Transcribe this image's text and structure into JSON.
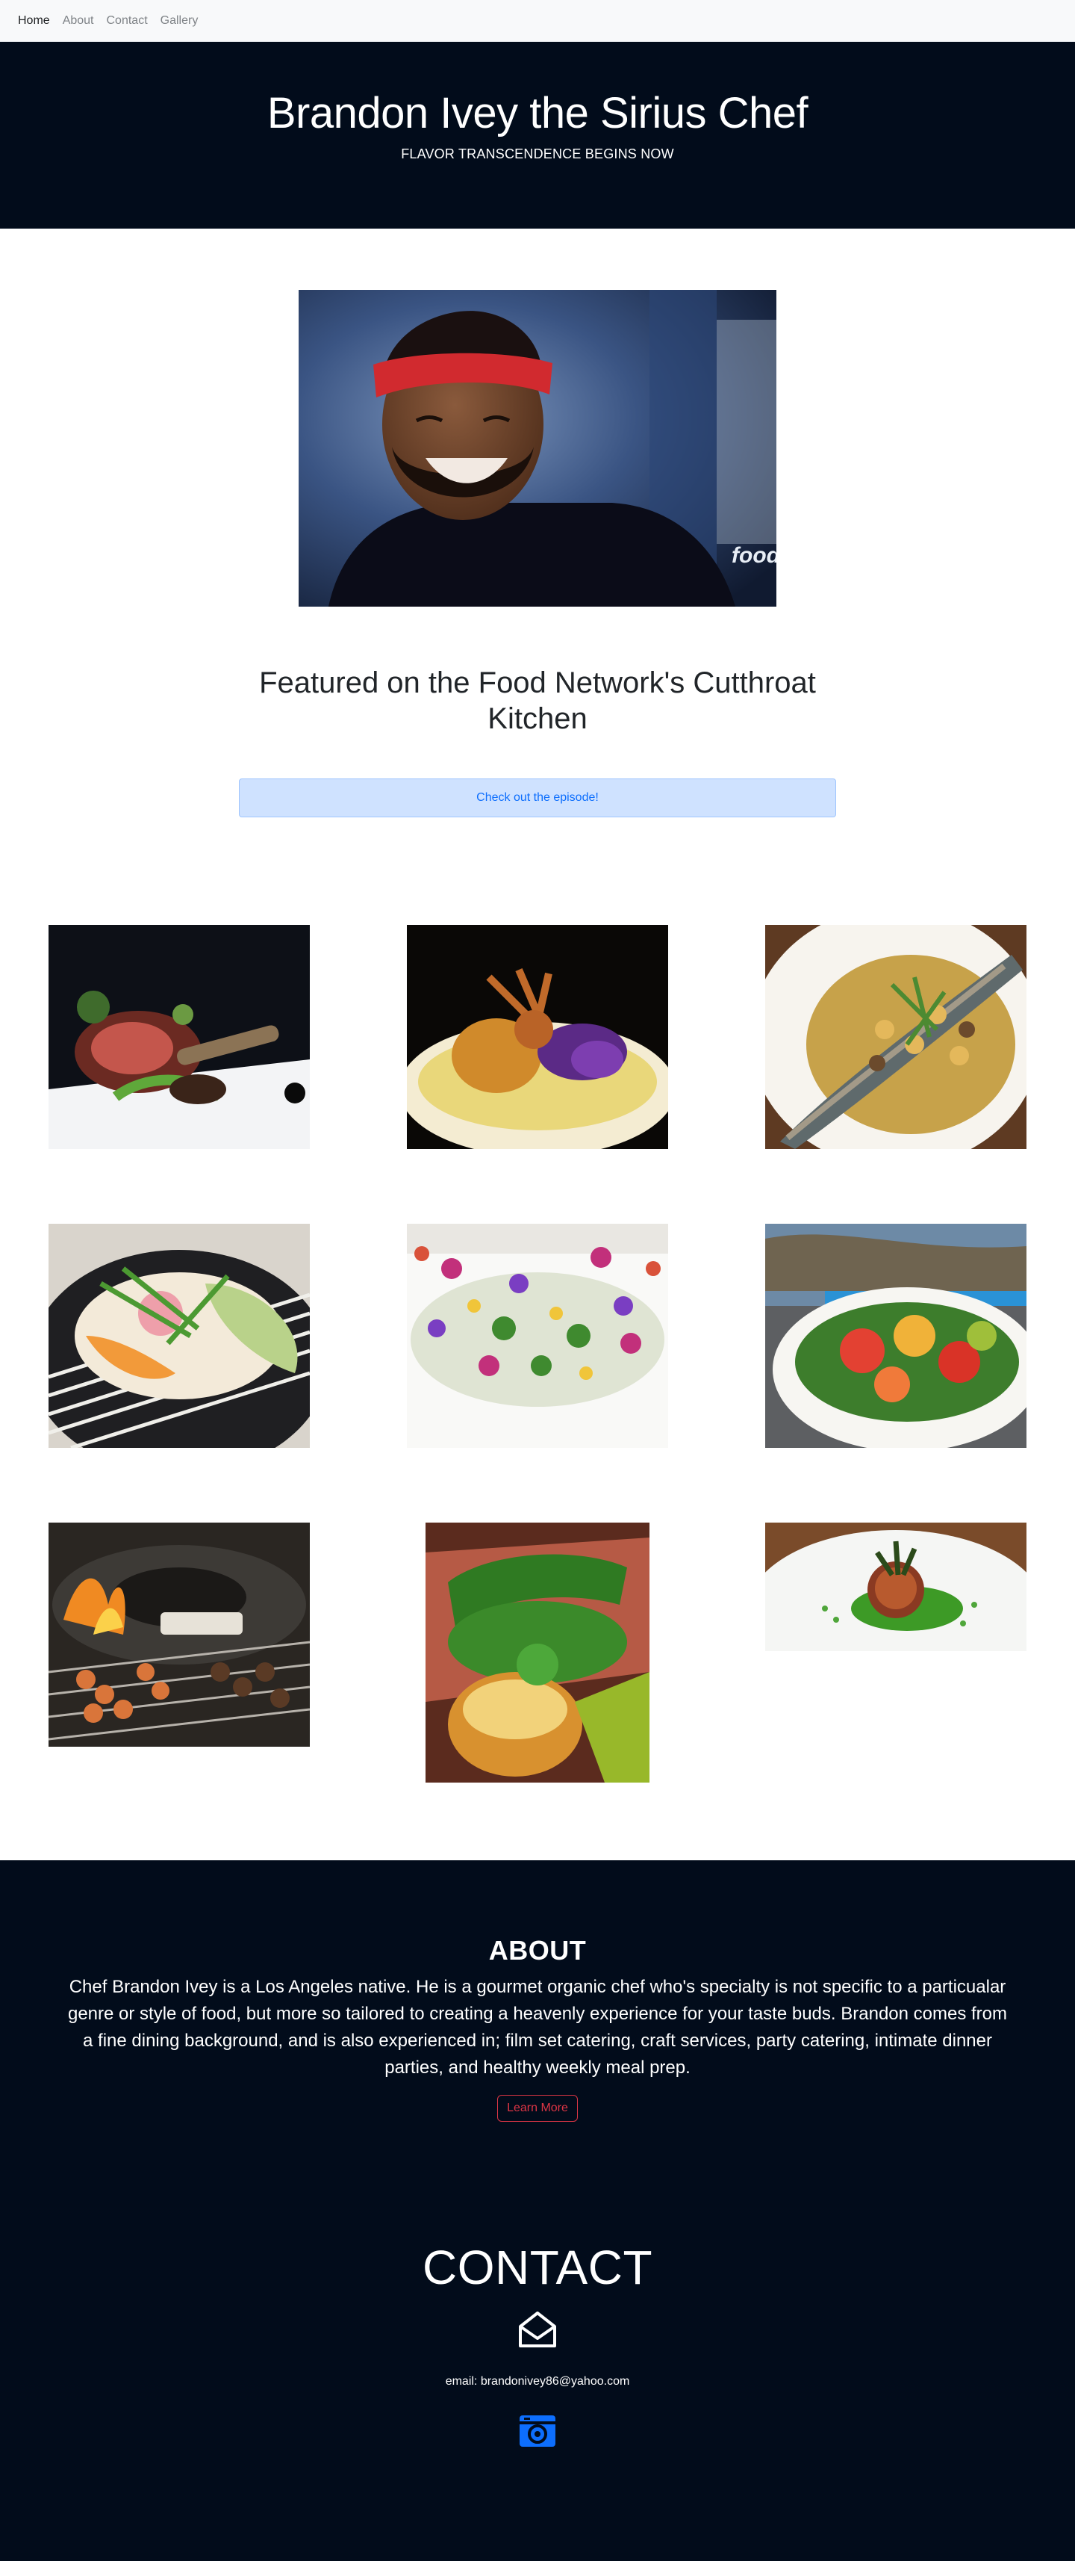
{
  "nav": {
    "items": [
      {
        "label": "Home",
        "active": true
      },
      {
        "label": "About",
        "active": false
      },
      {
        "label": "Contact",
        "active": false
      },
      {
        "label": "Gallery",
        "active": false
      }
    ]
  },
  "hero": {
    "title": "Brandon Ivey the Sirius Chef",
    "tagline": "FLAVOR TRANSCENDENCE BEGINS NOW"
  },
  "feature": {
    "heading": "Featured on the Food Network's Cutthroat Kitchen",
    "episode_button": "Check out the episode!"
  },
  "about": {
    "heading": "ABOUT",
    "body": "Chef Brandon Ivey is a Los Angeles native. He is a gourmet organic chef who's specialty is not specific to a particualar genre or style of food, but more so tailored to creating a heavenly experience for your taste buds. Brandon comes from a fine dining background, and is also experienced in; film set catering, craft services, party catering, intimate dinner parties, and healthy weekly meal prep.",
    "button": "Learn More"
  },
  "contact": {
    "heading": "CONTACT",
    "email": "email: brandonivey86@yahoo.com",
    "mail_icon": "envelope-open-icon",
    "camera_icon": "instagram-camera-icon"
  },
  "colors": {
    "dark_bg": "#020c1b",
    "nav_bg": "#f8f9fa",
    "episode_btn_bg": "#cfe2ff",
    "episode_btn_text": "#0d6efd",
    "learn_btn": "#dc3545",
    "camera_icon": "#0d6efd"
  }
}
